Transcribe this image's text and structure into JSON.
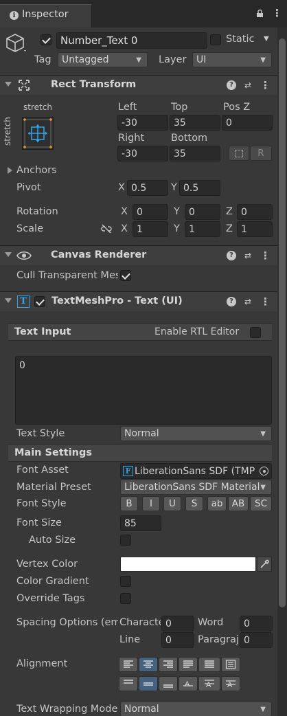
{
  "tab": {
    "title": "Inspector",
    "icon": "info-icon"
  },
  "object": {
    "name": "Number_Text 0",
    "active": true,
    "static_label": "Static",
    "tag_label": "Tag",
    "tag_value": "Untagged",
    "layer_label": "Layer",
    "layer_value": "UI"
  },
  "rect": {
    "title": "Rect Transform",
    "preset_h": "stretch",
    "preset_v": "stretch",
    "left_label": "Left",
    "left": "-30",
    "top_label": "Top",
    "top": "35",
    "posz_label": "Pos Z",
    "posz": "0",
    "right_label": "Right",
    "right": "-30",
    "bottom_label": "Bottom",
    "bottom": "35",
    "r_btn": "R",
    "anchors_label": "Anchors",
    "pivot_label": "Pivot",
    "pivot_x_label": "X",
    "pivot_x": "0.5",
    "pivot_y_label": "Y",
    "pivot_y": "0.5",
    "rotation_label": "Rotation",
    "rot_x_label": "X",
    "rot_x": "0",
    "rot_y_label": "Y",
    "rot_y": "0",
    "rot_z_label": "Z",
    "rot_z": "0",
    "scale_label": "Scale",
    "scale_x_label": "X",
    "scale_x": "1",
    "scale_y_label": "Y",
    "scale_y": "1",
    "scale_z_label": "Z",
    "scale_z": "1"
  },
  "canvas": {
    "title": "Canvas Renderer",
    "cull_label": "Cull Transparent Mes",
    "cull": true
  },
  "tmp": {
    "title": "TextMeshPro - Text (UI)",
    "enabled": true,
    "text_input_label": "Text Input",
    "rtl_label": "Enable RTL Editor",
    "text": "0",
    "text_style_label": "Text Style",
    "text_style": "Normal",
    "main_settings_label": "Main Settings",
    "font_asset_label": "Font Asset",
    "font_asset": "LiberationSans SDF (TMP",
    "material_label": "Material Preset",
    "material": "LiberationSans SDF Material",
    "font_style_label": "Font Style",
    "font_styles": [
      "B",
      "I",
      "U",
      "S",
      "ab",
      "AB",
      "SC"
    ],
    "font_size_label": "Font Size",
    "font_size": "85",
    "auto_size_label": "Auto Size",
    "vertex_color_label": "Vertex Color",
    "vertex_color": "#ffffff",
    "gradient_label": "Color Gradient",
    "override_label": "Override Tags",
    "spacing_label": "Spacing Options (em",
    "char_label": "Characte",
    "char": "0",
    "word_label": "Word",
    "word": "0",
    "line_label": "Line",
    "line": "0",
    "para_label": "Paragraj",
    "para": "0",
    "alignment_label": "Alignment",
    "wrap_label": "Text Wrapping Mode",
    "wrap": "Normal"
  },
  "colors": {
    "selected": "#46607f",
    "accent_blue": "#2ea3e6"
  }
}
